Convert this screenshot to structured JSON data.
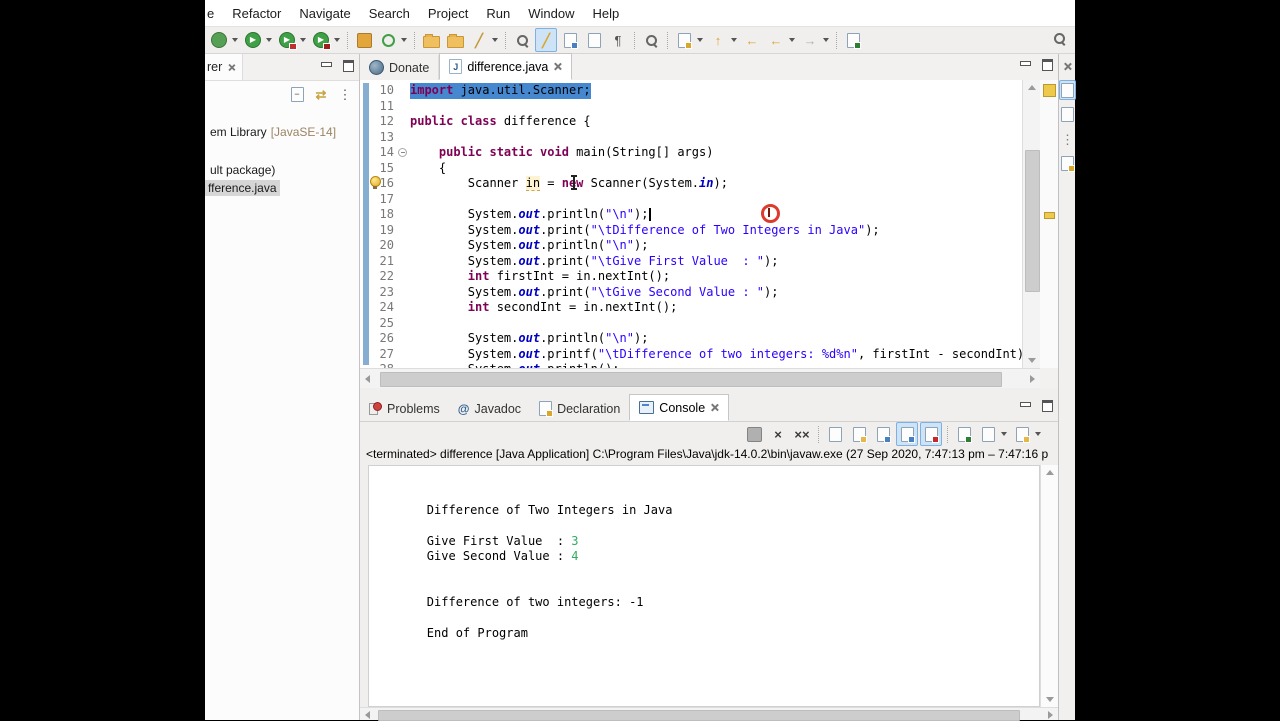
{
  "colors": {
    "selection_blue": "#4688d0",
    "keyword_magenta": "#7f0055",
    "string_blue": "#2a00ff",
    "field_blue": "#0000c0",
    "console_input_green": "#2fae60",
    "quickdiff_blue": "#86aed0",
    "toggle_highlight_bg": "#cfe3f6",
    "letterbox": "#000000"
  },
  "menu": {
    "items": [
      "e",
      "Refactor",
      "Navigate",
      "Search",
      "Project",
      "Run",
      "Window",
      "Help"
    ]
  },
  "main_toolbar": {
    "icons": [
      {
        "name": "debug-icon",
        "shape": "circle",
        "bg": "#55a055",
        "dd": true
      },
      {
        "name": "run-icon",
        "shape": "circle",
        "bg": "#3fa045",
        "glyph": "▶",
        "gc": "#ffffff",
        "dd": true
      },
      {
        "name": "run-coverage-icon",
        "shape": "circle",
        "bg": "#3fa045",
        "glyph": "▶",
        "gc": "#ffffff",
        "badge": "#c03030",
        "dd": true
      },
      {
        "name": "profile-icon",
        "shape": "circle",
        "bg": "#3fa045",
        "glyph": "▶",
        "gc": "#ffffff",
        "badge": "#a02020",
        "dd": true
      },
      {
        "name": "new-java-project-icon",
        "shape": "square",
        "bg": "#e2a63d",
        "sep": true
      },
      {
        "name": "open-wizard-icon",
        "shape": "ring",
        "dd": true
      },
      {
        "name": "open-folder-icon",
        "shape": "folder",
        "sep": true
      },
      {
        "name": "import-folder-icon",
        "shape": "folder"
      },
      {
        "name": "brush-icon",
        "shape": "glyph",
        "glyph": "╱",
        "gc": "#c59a3c",
        "bold": true,
        "dd": true
      },
      {
        "name": "plug-search-icon",
        "shape": "mag",
        "sep": true
      },
      {
        "name": "mark-occurrences-icon",
        "shape": "glyph",
        "glyph": "╱",
        "gc": "#d9a62e",
        "bold": true,
        "hl": true
      },
      {
        "name": "save-jump-icon",
        "shape": "doc",
        "dot": "#4a7fc0"
      },
      {
        "name": "show-template-icon",
        "shape": "doc"
      },
      {
        "name": "show-whitespace-icon",
        "shape": "glyph",
        "glyph": "¶",
        "gc": "#555555"
      },
      {
        "name": "dim-search-icon",
        "shape": "mag",
        "sep": true
      },
      {
        "name": "next-annotation-icon",
        "shape": "doc",
        "dot": "#d9a62e",
        "dd": true,
        "sep": true
      },
      {
        "name": "previous-annotation-icon",
        "shape": "glyph",
        "glyph": "↑",
        "gc": "#d9a62e",
        "bold": true,
        "dd": true
      },
      {
        "name": "last-edit-location-icon",
        "shape": "glyph",
        "glyph": "←",
        "gc": "#d9a62e",
        "bold": true
      },
      {
        "name": "back-icon",
        "shape": "glyph",
        "glyph": "←",
        "gc": "#d9a62e",
        "bold": true,
        "dd": true
      },
      {
        "name": "forward-icon",
        "shape": "glyph",
        "glyph": "→",
        "gc": "#b0b0b0",
        "dd": true
      },
      {
        "name": "open-new-window-icon",
        "shape": "doc",
        "dot": "#2e7d32",
        "sep": true
      }
    ]
  },
  "explorer": {
    "tab_label": "rer",
    "toolbar_icons": [
      {
        "name": "collapse-all-icon",
        "shape": "doc",
        "glyph": "−",
        "gc": "#444444"
      },
      {
        "name": "link-with-editor-icon",
        "shape": "glyph",
        "glyph": "⇄",
        "gc": "#c8a43c",
        "bold": true
      },
      {
        "name": "view-menu-icon",
        "shape": "glyph",
        "glyph": "⋮",
        "gc": "#555555"
      }
    ],
    "items": [
      {
        "label": "em Library",
        "decoration": "[JavaSE-14]"
      },
      {
        "label": "ult package)"
      },
      {
        "label": "fference.java",
        "selected": true
      }
    ]
  },
  "editor": {
    "tabs": [
      {
        "label": "Donate"
      },
      {
        "label": "difference.java",
        "icon_glyph": "J",
        "active": true
      }
    ],
    "lines": [
      {
        "n": "10",
        "sel": true,
        "tokens": [
          {
            "t": "import",
            "c": "kw"
          },
          {
            "t": " java.util.Scanner;",
            "c": "pl"
          }
        ]
      },
      {
        "n": "11",
        "tokens": []
      },
      {
        "n": "12",
        "tokens": [
          {
            "t": "public class",
            "c": "kw"
          },
          {
            "t": " difference {",
            "c": "pl"
          }
        ]
      },
      {
        "n": "13",
        "tokens": []
      },
      {
        "n": "14",
        "fold": true,
        "tokens": [
          {
            "t": "    ",
            "c": "pl"
          },
          {
            "t": "public static void",
            "c": "kw"
          },
          {
            "t": " main(String[] args)",
            "c": "pl"
          }
        ]
      },
      {
        "n": "15",
        "tokens": [
          {
            "t": "    {",
            "c": "pl"
          }
        ]
      },
      {
        "n": "16",
        "tokens": [
          {
            "t": "        Scanner ",
            "c": "pl"
          },
          {
            "t": "in",
            "c": "occ"
          },
          {
            "t": " = ",
            "c": "pl"
          },
          {
            "t": "new",
            "c": "kw"
          },
          {
            "t": " Scanner(System.",
            "c": "pl"
          },
          {
            "t": "in",
            "c": "fld"
          },
          {
            "t": ");",
            "c": "pl"
          }
        ]
      },
      {
        "n": "17",
        "tokens": []
      },
      {
        "n": "18",
        "caret": true,
        "tokens": [
          {
            "t": "        System.",
            "c": "pl"
          },
          {
            "t": "out",
            "c": "fld"
          },
          {
            "t": ".println(",
            "c": "pl"
          },
          {
            "t": "\"\\n\"",
            "c": "str"
          },
          {
            "t": ");",
            "c": "pl"
          }
        ]
      },
      {
        "n": "19",
        "tokens": [
          {
            "t": "        System.",
            "c": "pl"
          },
          {
            "t": "out",
            "c": "fld"
          },
          {
            "t": ".print(",
            "c": "pl"
          },
          {
            "t": "\"\\tDifference of Two Integers in Java\"",
            "c": "str"
          },
          {
            "t": ");",
            "c": "pl"
          }
        ]
      },
      {
        "n": "20",
        "tokens": [
          {
            "t": "        System.",
            "c": "pl"
          },
          {
            "t": "out",
            "c": "fld"
          },
          {
            "t": ".println(",
            "c": "pl"
          },
          {
            "t": "\"\\n\"",
            "c": "str"
          },
          {
            "t": ");",
            "c": "pl"
          }
        ]
      },
      {
        "n": "21",
        "tokens": [
          {
            "t": "        System.",
            "c": "pl"
          },
          {
            "t": "out",
            "c": "fld"
          },
          {
            "t": ".print(",
            "c": "pl"
          },
          {
            "t": "\"\\tGive First Value  : \"",
            "c": "str"
          },
          {
            "t": ");",
            "c": "pl"
          }
        ]
      },
      {
        "n": "22",
        "tokens": [
          {
            "t": "        ",
            "c": "pl"
          },
          {
            "t": "int",
            "c": "kw"
          },
          {
            "t": " firstInt = in.nextInt();",
            "c": "pl"
          }
        ]
      },
      {
        "n": "23",
        "tokens": [
          {
            "t": "        System.",
            "c": "pl"
          },
          {
            "t": "out",
            "c": "fld"
          },
          {
            "t": ".print(",
            "c": "pl"
          },
          {
            "t": "\"\\tGive Second Value : \"",
            "c": "str"
          },
          {
            "t": ");",
            "c": "pl"
          }
        ]
      },
      {
        "n": "24",
        "tokens": [
          {
            "t": "        ",
            "c": "pl"
          },
          {
            "t": "int",
            "c": "kw"
          },
          {
            "t": " secondInt = in.nextInt();",
            "c": "pl"
          }
        ]
      },
      {
        "n": "25",
        "tokens": []
      },
      {
        "n": "26",
        "tokens": [
          {
            "t": "        System.",
            "c": "pl"
          },
          {
            "t": "out",
            "c": "fld"
          },
          {
            "t": ".println(",
            "c": "pl"
          },
          {
            "t": "\"\\n\"",
            "c": "str"
          },
          {
            "t": ");",
            "c": "pl"
          }
        ]
      },
      {
        "n": "27",
        "tokens": [
          {
            "t": "        System.",
            "c": "pl"
          },
          {
            "t": "out",
            "c": "fld"
          },
          {
            "t": ".printf(",
            "c": "pl"
          },
          {
            "t": "\"\\tDifference of two integers: %d%n\"",
            "c": "str"
          },
          {
            "t": ", firstInt - secondInt);",
            "c": "pl"
          }
        ]
      },
      {
        "n": "28",
        "tokens": [
          {
            "t": "        System.",
            "c": "pl"
          },
          {
            "t": "out",
            "c": "fld"
          },
          {
            "t": ".println();",
            "c": "pl"
          }
        ]
      }
    ]
  },
  "bottom": {
    "tabs": [
      {
        "label": "Problems"
      },
      {
        "label": "Javadoc",
        "icon_glyph": "@"
      },
      {
        "label": "Declaration"
      },
      {
        "label": "Console",
        "active": true
      }
    ],
    "console_toolbar": {
      "icons": [
        {
          "name": "terminate-icon",
          "shape": "square",
          "bg": "#b0b0b0"
        },
        {
          "name": "remove-launch-icon",
          "shape": "glyph",
          "glyph": "×",
          "gc": "#3a3a3a",
          "bold": true
        },
        {
          "name": "remove-all-launches-icon",
          "shape": "glyph",
          "glyph": "××",
          "gc": "#3a3a3a",
          "bold": true
        },
        {
          "name": "clear-console-icon",
          "shape": "doc",
          "sep": true
        },
        {
          "name": "scroll-lock-icon",
          "shape": "doc",
          "dot": "#e6b84a"
        },
        {
          "name": "word-wrap-icon",
          "shape": "doc",
          "dot": "#4a7fc0"
        },
        {
          "name": "show-stdout-icon",
          "shape": "doc",
          "dot": "#4a7fc0",
          "hl": true
        },
        {
          "name": "show-stderr-icon",
          "shape": "doc",
          "dot": "#c62828",
          "hl": true
        },
        {
          "name": "pin-console-icon",
          "shape": "doc",
          "dot": "#2e7d32",
          "sep": true
        },
        {
          "name": "display-console-icon",
          "shape": "doc",
          "dd": true
        },
        {
          "name": "open-console-icon",
          "shape": "doc",
          "dot": "#e6b84a",
          "dd": true
        }
      ]
    },
    "header": "<terminated> difference [Java Application] C:\\Program Files\\Java\\jdk-14.0.2\\bin\\javaw.exe (27 Sep 2020, 7:47:13 pm – 7:47:16 p",
    "output": [
      [],
      [],
      [
        {
          "t": "        Difference of Two Integers in Java",
          "c": "out"
        }
      ],
      [],
      [
        {
          "t": "        Give First Value  : ",
          "c": "out"
        },
        {
          "t": "3",
          "c": "in"
        }
      ],
      [
        {
          "t": "        Give Second Value : ",
          "c": "out"
        },
        {
          "t": "4",
          "c": "in"
        }
      ],
      [],
      [],
      [
        {
          "t": "        Difference of two integers: -1",
          "c": "out"
        }
      ],
      [],
      [
        {
          "t": "        End of Program",
          "c": "out"
        }
      ]
    ]
  },
  "right_strip": {
    "icons": [
      {
        "name": "close-minimized-view-icon",
        "shape": "x"
      },
      {
        "name": "restore-outline-icon",
        "shape": "doc",
        "hl": true
      },
      {
        "name": "minimized-view-icon-1",
        "shape": "doc"
      },
      {
        "name": "minimized-view-icon-2",
        "shape": "glyph",
        "glyph": "⋮",
        "gc": "#777777"
      },
      {
        "name": "minimized-view-icon-3",
        "shape": "doc",
        "dot": "#d9a62e"
      }
    ]
  }
}
